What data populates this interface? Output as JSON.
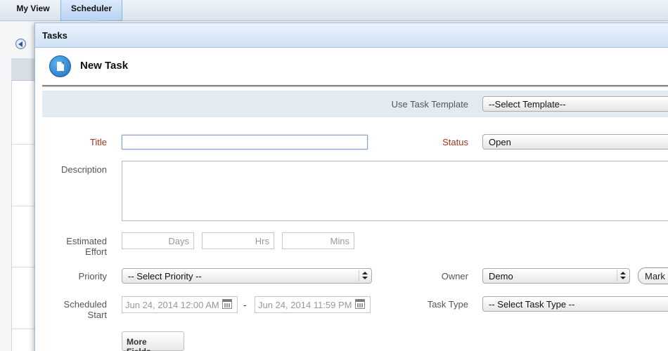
{
  "tabs": [
    {
      "label": "My View"
    },
    {
      "label": "Scheduler"
    }
  ],
  "dialog": {
    "title": "Tasks",
    "form_title": "New Task",
    "template": {
      "label": "Use Task Template",
      "value": "--Select Template--"
    },
    "title_field": {
      "label": "Title",
      "value": ""
    },
    "status": {
      "label": "Status",
      "value": "Open"
    },
    "description": {
      "label": "Description",
      "value": ""
    },
    "effort": {
      "label_line1": "Estimated",
      "label_line2": "Effort",
      "days": "Days",
      "hrs": "Hrs",
      "mins": "Mins"
    },
    "priority": {
      "label": "Priority",
      "value": "-- Select Priority --"
    },
    "owner": {
      "label": "Owner",
      "value": "Demo",
      "mark_button": "Mark"
    },
    "scheduled": {
      "label_line1": "Scheduled",
      "label_line2": "Start",
      "start": "Jun 24, 2014 12:00 AM",
      "dash": "-",
      "end": "Jun 24, 2014 11:59 PM"
    },
    "task_type": {
      "label": "Task Type",
      "value": "-- Select Task Type --"
    },
    "more_fields": "More Fields..."
  }
}
